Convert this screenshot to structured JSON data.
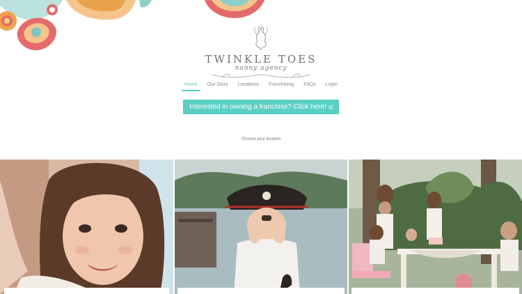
{
  "brand": {
    "name": "TWINKLE TOES",
    "tagline": "nanny agency"
  },
  "nav": {
    "items": [
      "Home",
      "Our Story",
      "Locations",
      "Franchising",
      "FAQs",
      "Login"
    ],
    "active": "Home"
  },
  "cta": {
    "label": "Interested in owning a franchise? Click here!",
    "icon": "external-link-icon"
  },
  "location_prompt": "Choose your location",
  "colors": {
    "accent": "#5ccfc4",
    "label_pink": "#e07b8a"
  }
}
